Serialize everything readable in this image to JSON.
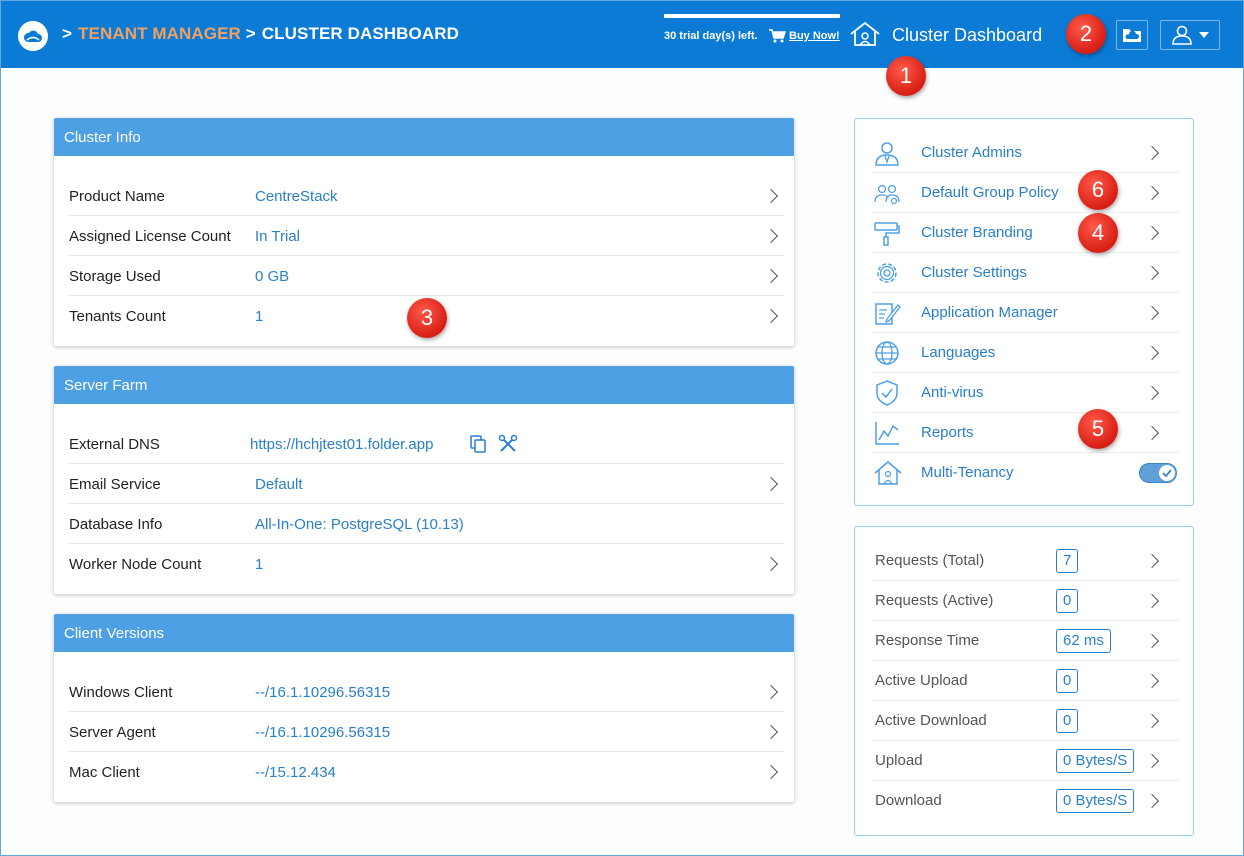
{
  "header": {
    "breadcrumb_sep": ">",
    "breadcrumb_tenant": "TENANT MANAGER",
    "breadcrumb_current": "CLUSTER DASHBOARD",
    "trial_text": "30 trial day(s) left.",
    "buy_label": "Buy Now!",
    "page_title": "Cluster Dashboard"
  },
  "markers": [
    "1",
    "2",
    "3",
    "4",
    "5",
    "6"
  ],
  "cluster_info": {
    "title": "Cluster Info",
    "rows": [
      {
        "label": "Product Name",
        "value": "CentreStack"
      },
      {
        "label": "Assigned License Count",
        "value": "In Trial"
      },
      {
        "label": "Storage Used",
        "value": "0 GB"
      },
      {
        "label": "Tenants Count",
        "value": "1"
      }
    ]
  },
  "server_farm": {
    "title": "Server Farm",
    "rows": [
      {
        "label": "External DNS",
        "value": "https://hchjtest01.folder.app"
      },
      {
        "label": "Email Service",
        "value": "Default"
      },
      {
        "label": "Database Info",
        "value": "All-In-One: PostgreSQL (10.13)"
      },
      {
        "label": "Worker Node Count",
        "value": "1"
      }
    ]
  },
  "client_versions": {
    "title": "Client Versions",
    "rows": [
      {
        "label": "Windows Client",
        "value": "--/16.1.10296.56315"
      },
      {
        "label": "Server Agent",
        "value": "--/16.1.10296.56315"
      },
      {
        "label": "Mac Client",
        "value": "--/15.12.434"
      }
    ]
  },
  "menu": {
    "items": [
      {
        "label": "Cluster Admins",
        "icon": "admin-user-icon"
      },
      {
        "label": "Default Group Policy",
        "icon": "group-policy-icon"
      },
      {
        "label": "Cluster Branding",
        "icon": "paint-roller-icon"
      },
      {
        "label": "Cluster Settings",
        "icon": "gear-icon"
      },
      {
        "label": "Application Manager",
        "icon": "app-manager-icon"
      },
      {
        "label": "Languages",
        "icon": "globe-icon"
      },
      {
        "label": "Anti-virus",
        "icon": "shield-icon"
      },
      {
        "label": "Reports",
        "icon": "chart-icon"
      },
      {
        "label": "Multi-Tenancy",
        "icon": "multi-tenancy-icon",
        "toggle_on": true
      }
    ]
  },
  "stats": {
    "rows": [
      {
        "label": "Requests (Total)",
        "value": "7"
      },
      {
        "label": "Requests (Active)",
        "value": "0"
      },
      {
        "label": "Response Time",
        "value": "62 ms"
      },
      {
        "label": "Active Upload",
        "value": "0"
      },
      {
        "label": "Active Download",
        "value": "0"
      },
      {
        "label": "Upload",
        "value": "0 Bytes/S"
      },
      {
        "label": "Download",
        "value": "0 Bytes/S"
      }
    ]
  },
  "colors": {
    "topbar": "#0b7bd6",
    "panel_header": "#4da0e4",
    "link": "#2a7fc9",
    "breadcrumb_tenant": "#f0a060",
    "marker": "#e0281c"
  }
}
